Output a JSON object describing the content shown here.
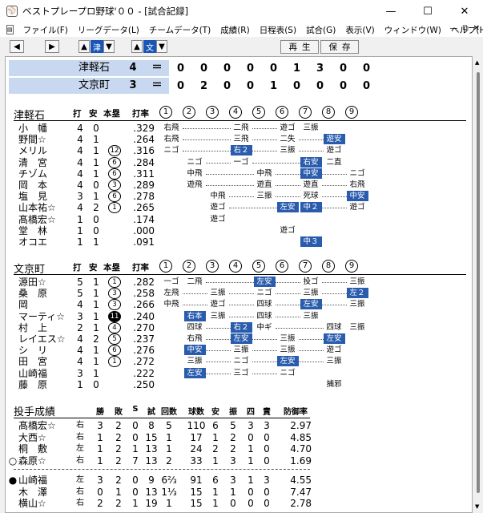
{
  "window": {
    "title": "ベストプレープロ野球'００ - [試合記録]",
    "icon": "baseball-icon"
  },
  "menus": [
    "ファイル(F)",
    "リーグデータ(L)",
    "チームデータ(T)",
    "成績(R)",
    "日程表(S)",
    "試合(G)",
    "表示(V)",
    "ウィンドウ(W)",
    "ヘルプ(H)"
  ],
  "toolbar": {
    "team1": "津",
    "team2": "文",
    "play": "再生",
    "save": "保存"
  },
  "scoreboard": [
    {
      "team": "津軽石",
      "runs": "4",
      "innings": [
        "0",
        "0",
        "0",
        "0",
        "0",
        "1",
        "3",
        "0",
        "0"
      ]
    },
    {
      "team": "文京町",
      "runs": "3",
      "innings": [
        "0",
        "2",
        "0",
        "0",
        "1",
        "0",
        "0",
        "0",
        "0"
      ]
    }
  ],
  "eq": "＝",
  "inning_labels": [
    "1",
    "2",
    "3",
    "4",
    "5",
    "6",
    "7",
    "8",
    "9"
  ],
  "headers": {
    "at_bats": "打",
    "hits": "安",
    "hr": "本塁",
    "avg": "打率"
  },
  "team1": {
    "name": "津軽石",
    "batters": [
      {
        "name": "小　幡",
        "ab": "4",
        "h": "0",
        "hr": "",
        "avg": ".329",
        "res": {
          "1": "右飛",
          "4": "二飛",
          "6": "遊ゴ",
          "7": "三振"
        }
      },
      {
        "name": "野間☆",
        "ab": "4",
        "h": "1",
        "hr": "",
        "avg": ".264",
        "res": {
          "1": "右飛",
          "4": "三飛",
          "6": "二失",
          "8": "遊安*"
        }
      },
      {
        "name": "メリル",
        "ab": "4",
        "h": "1",
        "hr": "12",
        "avg": ".316",
        "res": {
          "1": "ニゴ",
          "4": "右２*",
          "6": "三振",
          "8": "遊ゴ"
        }
      },
      {
        "name": "清　宮",
        "ab": "4",
        "h": "1",
        "hr": "6",
        "avg": ".284",
        "res": {
          "2": "ニゴ",
          "4": "一ゴ",
          "7": "右安*",
          "8": "二直"
        }
      },
      {
        "name": "チゾム",
        "ab": "4",
        "h": "1",
        "hr": "6",
        "avg": ".311",
        "res": {
          "2": "中飛",
          "5": "中飛",
          "7": "中安*",
          "9": "ニゴ"
        }
      },
      {
        "name": "岡　本",
        "ab": "4",
        "h": "0",
        "hr": "3",
        "avg": ".289",
        "res": {
          "2": "遊飛",
          "5": "遊直",
          "7": "遊直",
          "9": "右飛"
        }
      },
      {
        "name": "塩　見",
        "ab": "3",
        "h": "1",
        "hr": "6",
        "avg": ".278",
        "res": {
          "3": "中飛",
          "5": "三振",
          "7": "死球",
          "9": "中安*"
        }
      },
      {
        "name": "山本祐☆",
        "ab": "4",
        "h": "2",
        "hr": "1",
        "avg": ".265",
        "res": {
          "3": "遊ゴ",
          "6": "左安*",
          "7": "中２*",
          "9": "遊ゴ"
        }
      },
      {
        "name": "髙橋宏☆",
        "ab": "1",
        "h": "0",
        "hr": "",
        "avg": ".174",
        "res": {
          "3": "遊ゴ"
        }
      },
      {
        "name": "堂　林",
        "ab": "1",
        "h": "0",
        "hr": "",
        "avg": ".000",
        "res": {
          "6": "遊ゴ"
        }
      },
      {
        "name": "オコエ",
        "ab": "1",
        "h": "1",
        "hr": "",
        "avg": ".091",
        "res": {
          "7": "中３*"
        }
      }
    ]
  },
  "team2": {
    "name": "文京町",
    "batters": [
      {
        "name": "源田☆",
        "ab": "5",
        "h": "1",
        "hr": "1",
        "avg": ".282",
        "res": {
          "1": "一ゴ",
          "2": "二飛",
          "5": "左安*",
          "7": "投ゴ",
          "9": "三振"
        }
      },
      {
        "name": "桑　原",
        "ab": "5",
        "h": "1",
        "hr": "3",
        "avg": ".258",
        "res": {
          "1": "左飛",
          "3": "三振",
          "5": "ニゴ",
          "7": "三振",
          "9": "左２*"
        }
      },
      {
        "name": "岡",
        "ab": "4",
        "h": "1",
        "hr": "3",
        "avg": ".266",
        "res": {
          "1": "中飛",
          "3": "遊ゴ",
          "5": "四球",
          "7": "左安*",
          "9": "三振"
        }
      },
      {
        "name": "マーティ☆",
        "ab": "3",
        "h": "1",
        "hr": "11",
        "avg": ".240",
        "res": {
          "2": "右本*",
          "3": "三振",
          "5": "四球",
          "7": "三振"
        }
      },
      {
        "name": "村　上",
        "ab": "2",
        "h": "1",
        "hr": "4",
        "avg": ".270",
        "res": {
          "2": "四球",
          "4": "右２*",
          "5": "中ギ",
          "8": "四球",
          "9": "三振"
        }
      },
      {
        "name": "レイエス☆",
        "ab": "4",
        "h": "2",
        "hr": "5",
        "avg": ".237",
        "res": {
          "2": "右飛",
          "4": "左安*",
          "6": "三振",
          "8": "左安*"
        }
      },
      {
        "name": "シ　リ",
        "ab": "4",
        "h": "1",
        "hr": "6",
        "avg": ".276",
        "res": {
          "2": "中安*",
          "4": "三振",
          "6": "三振",
          "8": "遊ゴ"
        }
      },
      {
        "name": "田　宮",
        "ab": "4",
        "h": "1",
        "hr": "1",
        "avg": ".272",
        "res": {
          "2": "三振",
          "4": "ニゴ",
          "6": "左安*",
          "8": "三振"
        }
      },
      {
        "name": "山崎福",
        "ab": "3",
        "h": "1",
        "hr": "",
        "avg": ".222",
        "res": {
          "2": "左安*",
          "4": "三ゴ",
          "6": "ニゴ"
        }
      },
      {
        "name": "藤　原",
        "ab": "1",
        "h": "0",
        "hr": "",
        "avg": ".250",
        "res": {
          "8": "捕邪"
        }
      }
    ]
  },
  "pitching": {
    "title": "投手成績",
    "headers": [
      "勝",
      "敗",
      "S",
      "試",
      "回数",
      "球数",
      "安",
      "振",
      "四",
      "責",
      "防御率"
    ],
    "team1": [
      {
        "mark": "",
        "name": "髙橋宏☆",
        "hand": "右",
        "vals": [
          "3",
          "2",
          "0",
          "8",
          "5",
          "110",
          "6",
          "5",
          "3",
          "3",
          "2.97"
        ]
      },
      {
        "mark": "",
        "name": "大西☆",
        "hand": "右",
        "vals": [
          "1",
          "2",
          "0",
          "15",
          "1",
          "17",
          "1",
          "2",
          "0",
          "0",
          "4.85"
        ]
      },
      {
        "mark": "",
        "name": "桐　敷",
        "hand": "左",
        "vals": [
          "1",
          "2",
          "1",
          "13",
          "1",
          "24",
          "2",
          "2",
          "1",
          "0",
          "4.70"
        ]
      },
      {
        "mark": "○",
        "name": "森原☆",
        "hand": "右",
        "vals": [
          "1",
          "2",
          "7",
          "13",
          "2",
          "33",
          "1",
          "3",
          "1",
          "0",
          "1.69"
        ]
      }
    ],
    "team2": [
      {
        "mark": "●",
        "name": "山崎福",
        "hand": "左",
        "vals": [
          "3",
          "2",
          "0",
          "9",
          "6⅔",
          "91",
          "6",
          "3",
          "1",
          "3",
          "4.55"
        ]
      },
      {
        "mark": "",
        "name": "木　澤",
        "hand": "右",
        "vals": [
          "0",
          "1",
          "0",
          "13",
          "1⅓",
          "15",
          "1",
          "1",
          "0",
          "0",
          "7.47"
        ]
      },
      {
        "mark": "",
        "name": "横山☆",
        "hand": "右",
        "vals": [
          "2",
          "2",
          "1",
          "19",
          "1",
          "15",
          "1",
          "0",
          "0",
          "0",
          "2.78"
        ]
      }
    ]
  },
  "colors": {
    "hit": "#2a5cad",
    "score_bg": "#c8d8f0",
    "selected": "#1a56b8"
  }
}
